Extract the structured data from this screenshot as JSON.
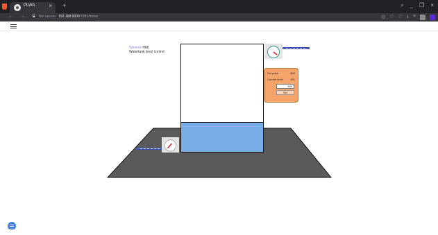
{
  "browser": {
    "tab_title": "PLWA",
    "tab_close": "×",
    "new_tab": "+",
    "url_warning": "Not secure",
    "url_host": "192.168.0000",
    "url_path": ":1881/home",
    "nav_back": "←",
    "nav_forward": "→",
    "nav_reload": "C",
    "window_controls": [
      "⌕",
      "_",
      "❐",
      "×"
    ],
    "ext_icons": [
      "◎",
      "♡",
      "♡",
      "⤓",
      "≡"
    ]
  },
  "hmi": {
    "title_line1_prefix": "Weintek",
    "title_line1_suffix": "HMI",
    "title_line2": "Watertank level control"
  },
  "panel": {
    "setpoint_label": "Set point",
    "setpoint_value": "800",
    "current_label": "Current level",
    "current_value": "251",
    "input_value": "800",
    "set_button": "Set"
  },
  "tank": {
    "fill_fraction": 0.28,
    "water_color": "#7aaee6"
  },
  "colors": {
    "platform": "#5a5a5a",
    "panel": "#f4a46a",
    "pipe": "#5a6ec9"
  }
}
